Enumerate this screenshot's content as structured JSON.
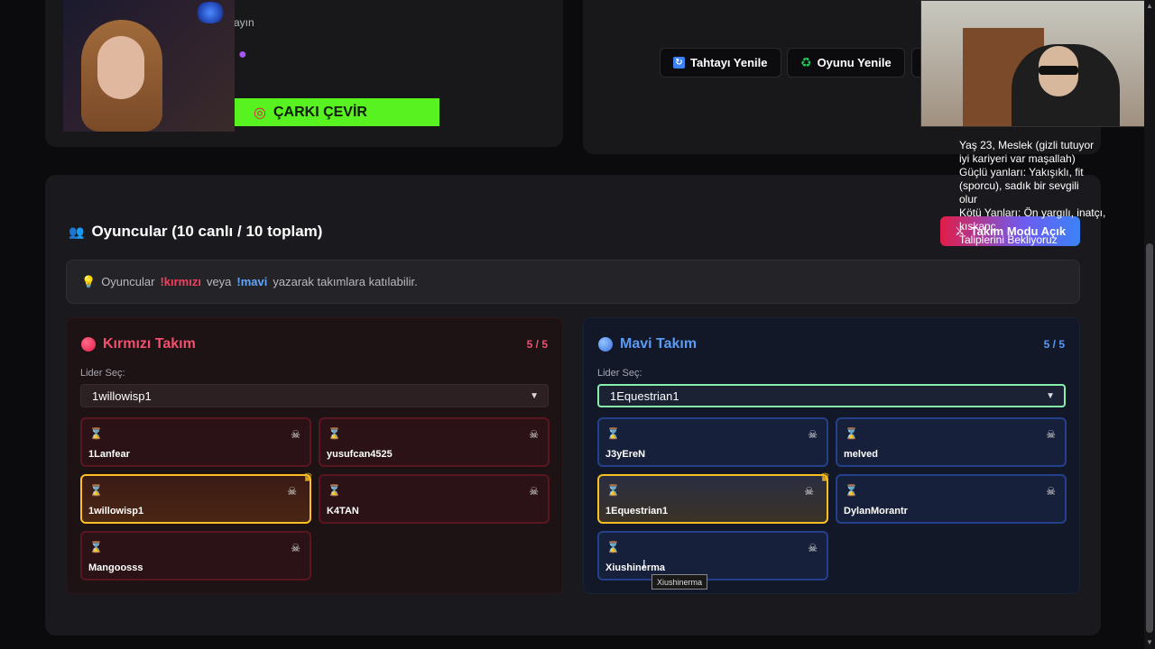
{
  "header": {
    "partial_text": "ayın",
    "spin_button": "ÇARKI ÇEVİR",
    "refresh_board": "Tahtayı Yenile",
    "restart_game": "Oyunu Yenile"
  },
  "players_section": {
    "title": "Oyuncular (10 canlı / 10 toplam)",
    "team_mode": "Takım Modu Açık",
    "info": {
      "prefix": "Oyuncular",
      "red_cmd": "!kırmızı",
      "or": "veya",
      "blue_cmd": "!mavi",
      "suffix": "yazarak takımlara katılabilir."
    }
  },
  "teams": {
    "red": {
      "name": "Kırmızı Takım",
      "count": "5 / 5",
      "leader_label": "Lider Seç:",
      "leader_selected": "1willowisp1",
      "players": [
        "1Lanfear",
        "yusufcan4525",
        "1willowisp1",
        "K4TAN",
        "Mangoosss"
      ]
    },
    "blue": {
      "name": "Mavi Takım",
      "count": "5 / 5",
      "leader_label": "Lider Seç:",
      "leader_selected": "1Equestrian1",
      "players": [
        "J3yEreN",
        "melved",
        "1Equestrian1",
        "DylanMorantr",
        "Xiushinerma"
      ]
    }
  },
  "tooltip": "Xiushinerma",
  "overlay_text": "Yaş 23, Meslek (gizli tutuyor\niyi kariyeri var maşallah)\nGüçlü yanları: Yakışıklı, fit\n(sporcu), sadık bir sevgili\nolur\nKötü Yanları: Ön yargılı, inatçı,\nkıskanç\nTaliplerini Bekliyoruz",
  "icons": {
    "hourglass": "hourglass-icon",
    "skull": "skull-crossbones-icon",
    "crown": "crown-icon"
  },
  "colors": {
    "red_accent": "#f2506e",
    "blue_accent": "#5b9bf5",
    "spin_green": "#57f21f",
    "leader_gold": "#fbbf24"
  }
}
